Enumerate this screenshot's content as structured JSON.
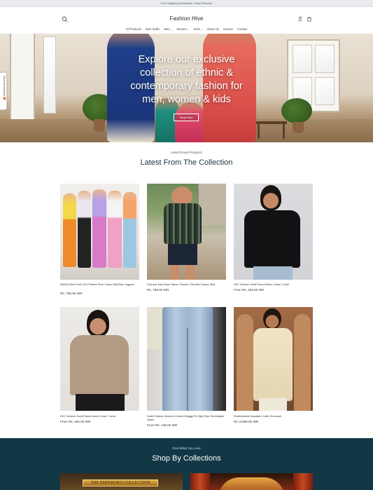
{
  "announcement": "Free Shipping Worldwide • Easy Returns!",
  "header": {
    "brand": "Fashion Hive",
    "icons": {
      "search": "search-icon",
      "account": "user-icon",
      "cart": "cart-icon"
    }
  },
  "nav": {
    "items": [
      {
        "label": "All Products",
        "dropdown": false
      },
      {
        "label": "Best Seller",
        "dropdown": false
      },
      {
        "label": "Men",
        "dropdown": true
      },
      {
        "label": "Women",
        "dropdown": true
      },
      {
        "label": "Kid's",
        "dropdown": true
      },
      {
        "label": "About Us",
        "dropdown": false
      },
      {
        "label": "Service",
        "dropdown": false
      },
      {
        "label": "Contact",
        "dropdown": false
      }
    ]
  },
  "hero": {
    "headline": "Explore our exclusive collection of ethnic & contemporary fashion for men, women & kids",
    "cta": "Shop Now"
  },
  "side_tab": "Discount unlocked 🎁",
  "latest": {
    "subheading": "Hand Picked Products",
    "title": "Latest From The Collection",
    "products": [
      {
        "title": "PAZZA Girls Pack Of 5 Printed Pure Cotton Mid-Rise Joggers",
        "price": "Rs. 799.00 INR"
      },
      {
        "title": "Doll and Jolly Boys Tartan Checks Checked Casual Shirt",
        "price": "Rs. 799.00 INR"
      },
      {
        "title": "DKY Women Solid Round Neck Cotton T-shirt",
        "price": "From Rs. 284.00 INR"
      },
      {
        "title": "DKY Women Solid Round Neck Cotton T-shirt",
        "price": "From Rs. 284.00 INR"
      },
      {
        "title": "Kalini Fashion Women Comfort Baggy Fit High-Rise Stretchable Jeans",
        "price": "From Rs. 139.00 INR"
      },
      {
        "title": "Embroidered Mandarin Collar Sherwani",
        "price": "Rs. 8,999.00 INR"
      }
    ]
  },
  "collections": {
    "subheading": "Find What You Love",
    "title": "Shop By Collections",
    "cards": [
      {
        "banner": "THE EMPEROR'S COLLECTION"
      },
      {
        "banner": ""
      }
    ]
  },
  "colors": {
    "accent": "#123845",
    "announcement_bg": "#e9ebee",
    "text": "#1f2b33"
  }
}
